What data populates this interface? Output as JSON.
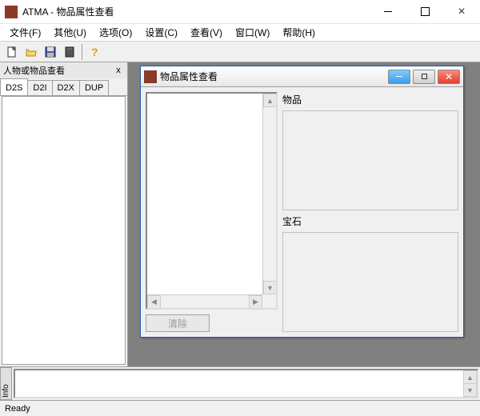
{
  "titlebar": {
    "title": "ATMA - 物品属性查看"
  },
  "menubar": {
    "file": "文件(F)",
    "other": "其他(U)",
    "options": "选项(O)",
    "settings": "设置(C)",
    "view": "查看(V)",
    "window": "窗口(W)",
    "help": "帮助(H)"
  },
  "toolbar_icons": {
    "new": "new-icon",
    "open": "open-icon",
    "save": "save-icon",
    "delete": "delete-icon",
    "help": "help-icon"
  },
  "sidebar": {
    "title": "人物或物品查看",
    "close": "x",
    "tabs": [
      "D2S",
      "D2I",
      "D2X",
      "DUP"
    ]
  },
  "child_window": {
    "title": "物品属性查看",
    "clear_button": "清除",
    "labels": {
      "item": "物品",
      "gem": "宝石"
    }
  },
  "info_panel": {
    "tab": "Info"
  },
  "statusbar": {
    "text": "Ready"
  }
}
